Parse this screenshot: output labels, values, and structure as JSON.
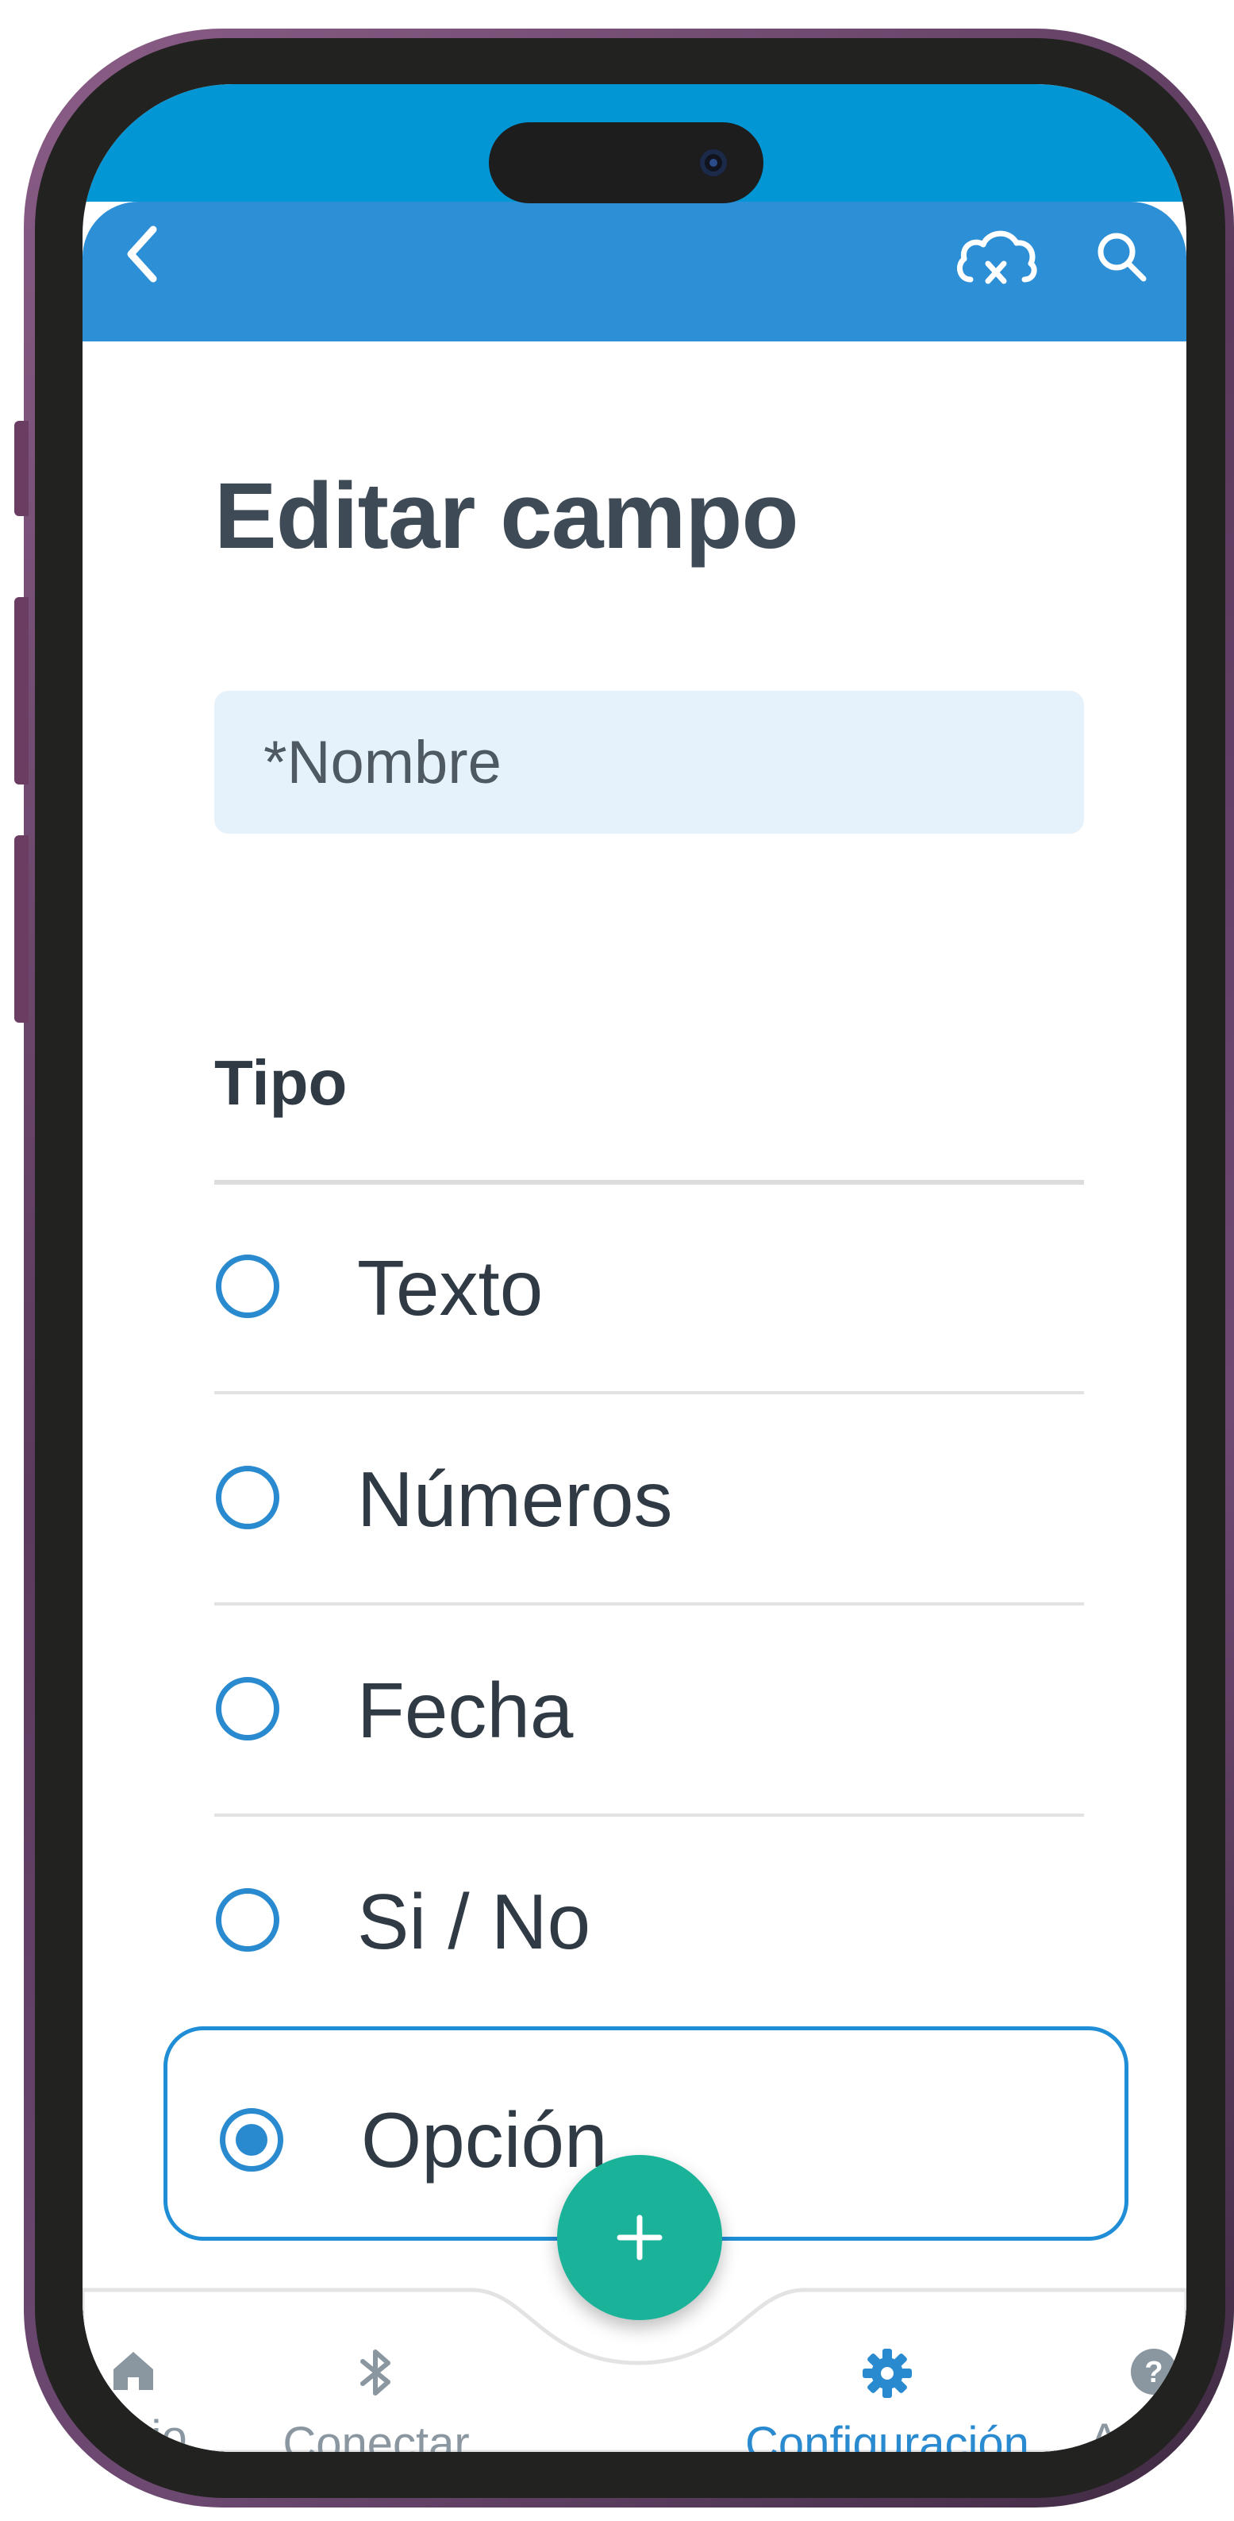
{
  "appbar": {
    "back_icon": "chevron-left-icon",
    "cloud_icon": "cloud-off-icon",
    "search_icon": "search-icon"
  },
  "page": {
    "title": "Editar campo",
    "name_field_placeholder": "*Nombre",
    "type_section_label": "Tipo"
  },
  "type_options": [
    {
      "label": "Texto",
      "selected": false
    },
    {
      "label": "Números",
      "selected": false
    },
    {
      "label": "Fecha",
      "selected": false
    },
    {
      "label": "Si / No",
      "selected": false
    },
    {
      "label": "Opción",
      "selected": true
    }
  ],
  "fab": {
    "icon": "plus-icon"
  },
  "bottom_nav": {
    "items": [
      {
        "label": "Inicio",
        "icon": "home-icon",
        "active": false
      },
      {
        "label": "Conectar",
        "icon": "bluetooth-icon",
        "active": false
      },
      {
        "label": "Configuración",
        "icon": "gear-icon",
        "active": true
      },
      {
        "label": "Ayuda",
        "icon": "help-icon",
        "active": false
      }
    ]
  },
  "colors": {
    "status_bar": "#0296d5",
    "app_bar": "#2d8fd6",
    "accent": "#2a8ad0",
    "fab": "#1ab39a",
    "field_bg": "#e6f2fb",
    "frame": "#222220"
  }
}
